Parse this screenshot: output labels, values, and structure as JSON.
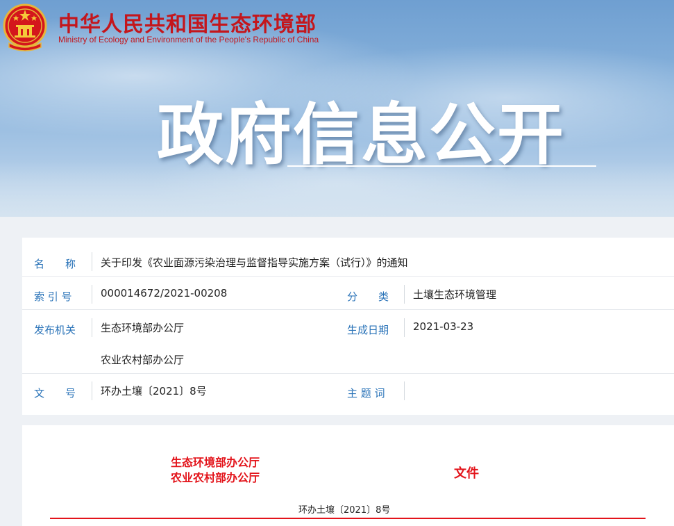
{
  "header": {
    "site_name_cn": "中华人民共和国生态环境部",
    "site_name_en": "Ministry of Ecology and Environment of the People's Republic of China",
    "emblem_icon": "national-emblem-icon",
    "banner_title": "政府信息公开",
    "brand_color": "#c4161c"
  },
  "info": {
    "name_label": "名　　称",
    "name_value": "关于印发《农业面源污染治理与监督指导实施方案（试行）》的通知",
    "index_label": "索 引 号",
    "index_value": "000014672/2021-00208",
    "category_label": "分　　类",
    "category_value": "土壤生态环境管理",
    "issuer_label": "发布机关",
    "issuer_values": [
      "生态环境部办公厅",
      "农业农村部办公厅"
    ],
    "date_label": "生成日期",
    "date_value": "2021-03-23",
    "docno_label": "文　　号",
    "docno_value": "环办土壤〔2021〕8号",
    "keywords_label": "主 题 词",
    "keywords_value": "",
    "label_color": "#2a73b8"
  },
  "document": {
    "issuers": [
      "生态环境部办公厅",
      "农业农村部办公厅"
    ],
    "wenjian": "文件",
    "doc_number": "环办土壤〔2021〕8号",
    "accent_color": "#e3141b"
  }
}
